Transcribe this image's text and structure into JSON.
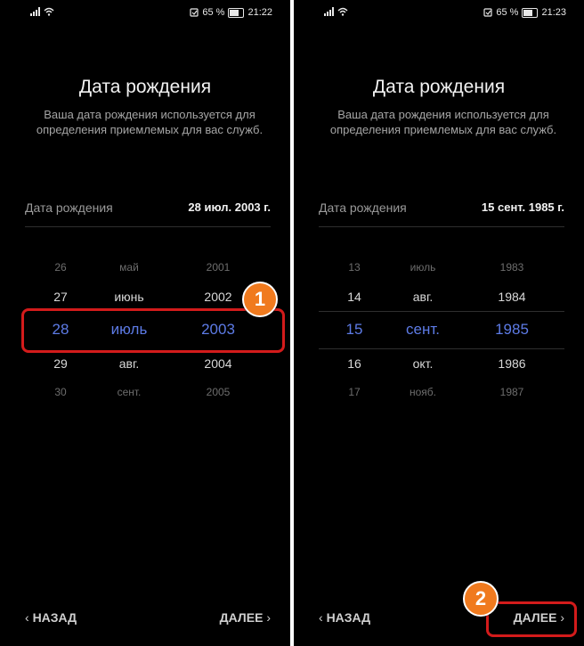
{
  "screens": [
    {
      "status": {
        "battery": "65 %",
        "time": "21:22"
      },
      "title": "Дата рождения",
      "description": "Ваша дата рождения используется для определения приемлемых для вас служб.",
      "dob_label": "Дата рождения",
      "dob_value": "28 июл. 2003 г.",
      "picker": {
        "days": [
          "26",
          "27",
          "28",
          "29",
          "30"
        ],
        "months": [
          "май",
          "июнь",
          "июль",
          "авг.",
          "сент."
        ],
        "years": [
          "2001",
          "2002",
          "2003",
          "2004",
          "2005"
        ]
      },
      "back_label": "НАЗАД",
      "next_label": "ДАЛЕЕ"
    },
    {
      "status": {
        "battery": "65 %",
        "time": "21:23"
      },
      "title": "Дата рождения",
      "description": "Ваша дата рождения используется для определения приемлемых для вас служб.",
      "dob_label": "Дата рождения",
      "dob_value": "15 сент. 1985 г.",
      "picker": {
        "days": [
          "13",
          "14",
          "15",
          "16",
          "17"
        ],
        "months": [
          "июль",
          "авг.",
          "сент.",
          "окт.",
          "нояб."
        ],
        "years": [
          "1983",
          "1984",
          "1985",
          "1986",
          "1987"
        ]
      },
      "back_label": "НАЗАД",
      "next_label": "ДАЛЕЕ"
    }
  ],
  "annotations": {
    "badge1": "1",
    "badge2": "2",
    "highlight_color": "#d31b1b",
    "badge_color": "#f07a1e"
  },
  "colors": {
    "selected": "#5d7be6",
    "background": "#000000"
  },
  "icons": [
    "signal-icon",
    "wifi-icon",
    "notification-icon",
    "battery-icon",
    "chevron-left-icon",
    "chevron-right-icon"
  ]
}
